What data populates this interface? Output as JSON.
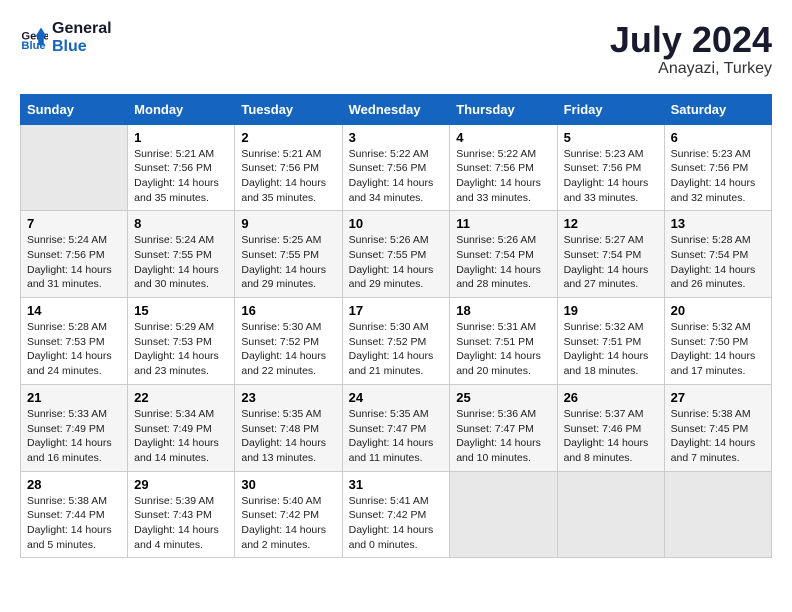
{
  "header": {
    "logo_line1": "General",
    "logo_line2": "Blue",
    "month": "July 2024",
    "location": "Anayazi, Turkey"
  },
  "days_of_week": [
    "Sunday",
    "Monday",
    "Tuesday",
    "Wednesday",
    "Thursday",
    "Friday",
    "Saturday"
  ],
  "weeks": [
    [
      {
        "day": "",
        "info": ""
      },
      {
        "day": "1",
        "info": "Sunrise: 5:21 AM\nSunset: 7:56 PM\nDaylight: 14 hours\nand 35 minutes."
      },
      {
        "day": "2",
        "info": "Sunrise: 5:21 AM\nSunset: 7:56 PM\nDaylight: 14 hours\nand 35 minutes."
      },
      {
        "day": "3",
        "info": "Sunrise: 5:22 AM\nSunset: 7:56 PM\nDaylight: 14 hours\nand 34 minutes."
      },
      {
        "day": "4",
        "info": "Sunrise: 5:22 AM\nSunset: 7:56 PM\nDaylight: 14 hours\nand 33 minutes."
      },
      {
        "day": "5",
        "info": "Sunrise: 5:23 AM\nSunset: 7:56 PM\nDaylight: 14 hours\nand 33 minutes."
      },
      {
        "day": "6",
        "info": "Sunrise: 5:23 AM\nSunset: 7:56 PM\nDaylight: 14 hours\nand 32 minutes."
      }
    ],
    [
      {
        "day": "7",
        "info": "Sunrise: 5:24 AM\nSunset: 7:56 PM\nDaylight: 14 hours\nand 31 minutes."
      },
      {
        "day": "8",
        "info": "Sunrise: 5:24 AM\nSunset: 7:55 PM\nDaylight: 14 hours\nand 30 minutes."
      },
      {
        "day": "9",
        "info": "Sunrise: 5:25 AM\nSunset: 7:55 PM\nDaylight: 14 hours\nand 29 minutes."
      },
      {
        "day": "10",
        "info": "Sunrise: 5:26 AM\nSunset: 7:55 PM\nDaylight: 14 hours\nand 29 minutes."
      },
      {
        "day": "11",
        "info": "Sunrise: 5:26 AM\nSunset: 7:54 PM\nDaylight: 14 hours\nand 28 minutes."
      },
      {
        "day": "12",
        "info": "Sunrise: 5:27 AM\nSunset: 7:54 PM\nDaylight: 14 hours\nand 27 minutes."
      },
      {
        "day": "13",
        "info": "Sunrise: 5:28 AM\nSunset: 7:54 PM\nDaylight: 14 hours\nand 26 minutes."
      }
    ],
    [
      {
        "day": "14",
        "info": "Sunrise: 5:28 AM\nSunset: 7:53 PM\nDaylight: 14 hours\nand 24 minutes."
      },
      {
        "day": "15",
        "info": "Sunrise: 5:29 AM\nSunset: 7:53 PM\nDaylight: 14 hours\nand 23 minutes."
      },
      {
        "day": "16",
        "info": "Sunrise: 5:30 AM\nSunset: 7:52 PM\nDaylight: 14 hours\nand 22 minutes."
      },
      {
        "day": "17",
        "info": "Sunrise: 5:30 AM\nSunset: 7:52 PM\nDaylight: 14 hours\nand 21 minutes."
      },
      {
        "day": "18",
        "info": "Sunrise: 5:31 AM\nSunset: 7:51 PM\nDaylight: 14 hours\nand 20 minutes."
      },
      {
        "day": "19",
        "info": "Sunrise: 5:32 AM\nSunset: 7:51 PM\nDaylight: 14 hours\nand 18 minutes."
      },
      {
        "day": "20",
        "info": "Sunrise: 5:32 AM\nSunset: 7:50 PM\nDaylight: 14 hours\nand 17 minutes."
      }
    ],
    [
      {
        "day": "21",
        "info": "Sunrise: 5:33 AM\nSunset: 7:49 PM\nDaylight: 14 hours\nand 16 minutes."
      },
      {
        "day": "22",
        "info": "Sunrise: 5:34 AM\nSunset: 7:49 PM\nDaylight: 14 hours\nand 14 minutes."
      },
      {
        "day": "23",
        "info": "Sunrise: 5:35 AM\nSunset: 7:48 PM\nDaylight: 14 hours\nand 13 minutes."
      },
      {
        "day": "24",
        "info": "Sunrise: 5:35 AM\nSunset: 7:47 PM\nDaylight: 14 hours\nand 11 minutes."
      },
      {
        "day": "25",
        "info": "Sunrise: 5:36 AM\nSunset: 7:47 PM\nDaylight: 14 hours\nand 10 minutes."
      },
      {
        "day": "26",
        "info": "Sunrise: 5:37 AM\nSunset: 7:46 PM\nDaylight: 14 hours\nand 8 minutes."
      },
      {
        "day": "27",
        "info": "Sunrise: 5:38 AM\nSunset: 7:45 PM\nDaylight: 14 hours\nand 7 minutes."
      }
    ],
    [
      {
        "day": "28",
        "info": "Sunrise: 5:38 AM\nSunset: 7:44 PM\nDaylight: 14 hours\nand 5 minutes."
      },
      {
        "day": "29",
        "info": "Sunrise: 5:39 AM\nSunset: 7:43 PM\nDaylight: 14 hours\nand 4 minutes."
      },
      {
        "day": "30",
        "info": "Sunrise: 5:40 AM\nSunset: 7:42 PM\nDaylight: 14 hours\nand 2 minutes."
      },
      {
        "day": "31",
        "info": "Sunrise: 5:41 AM\nSunset: 7:42 PM\nDaylight: 14 hours\nand 0 minutes."
      },
      {
        "day": "",
        "info": ""
      },
      {
        "day": "",
        "info": ""
      },
      {
        "day": "",
        "info": ""
      }
    ]
  ]
}
